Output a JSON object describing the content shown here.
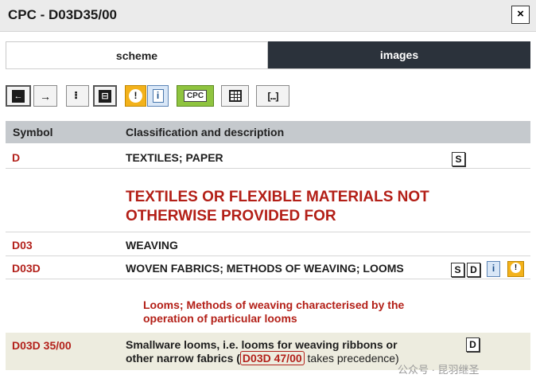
{
  "window": {
    "title": "CPC - D03D35/00",
    "close_label": "×"
  },
  "tabs": [
    {
      "label": "scheme",
      "active": true
    },
    {
      "label": "images",
      "active": false
    }
  ],
  "toolbar": {
    "prev_label": "←",
    "next_label": "→",
    "cpc_label": "CPC",
    "info_label": "i",
    "warn_label": "!",
    "ellipsis_label": "[...]",
    "collapse_label": "⠇",
    "expand_label": "⊟"
  },
  "table": {
    "columns": [
      "Symbol",
      "Classification and description"
    ],
    "rows": [
      {
        "symbol": "D",
        "description": "TEXTILES; PAPER"
      },
      {
        "symbol": "D03",
        "description": "WEAVING"
      },
      {
        "symbol": "D03D",
        "description": "WOVEN FABRICS; METHODS OF WEAVING; LOOMS"
      },
      {
        "symbol": "D03D 35/00",
        "description_1": "Smallware looms, i.e. looms for weaving ribbons or",
        "description_2": "other narrow fabrics (",
        "ref": "D03D 47/00",
        "description_3": " takes precedence)"
      }
    ],
    "section_heading_1": "TEXTILES OR FLEXIBLE MATERIALS NOT",
    "section_heading_2": "OTHERWISE PROVIDED FOR",
    "subgroup_note_1": "Looms; Methods of weaving characterised by the",
    "subgroup_note_2": "operation of particular looms"
  },
  "icons": {
    "s_icon": "S",
    "d_icon": "D",
    "i_icon": "i",
    "warn_icon": "!"
  },
  "watermark": "公众号 · 昆羽继圣",
  "colors": {
    "symbol_red": "#b3211b",
    "header_gray": "#c5c9cd",
    "tab_dark": "#2b323b",
    "cpc_green": "#8fc43f",
    "warn_orange": "#f3b21b"
  }
}
